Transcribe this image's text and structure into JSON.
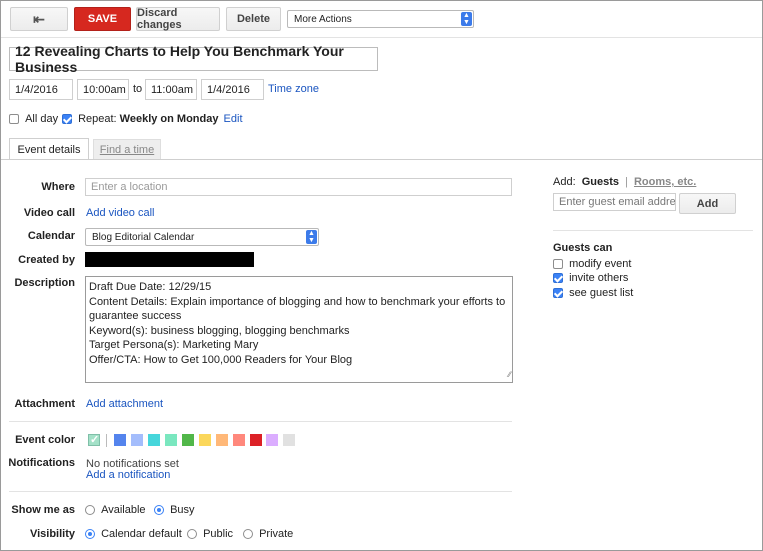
{
  "toolbar": {
    "back_icon": "back-arrow-icon",
    "save_label": "SAVE",
    "discard_label": "Discard changes",
    "delete_label": "Delete",
    "more_actions": "More Actions"
  },
  "event": {
    "title": "12 Revealing Charts to Help You Benchmark Your Business",
    "start_date": "1/4/2016",
    "start_time": "10:00am",
    "to_label": "to",
    "end_time": "11:00am",
    "end_date": "1/4/2016",
    "timezone_link": "Time zone",
    "allday_label": "All day",
    "repeat_label": "Repeat:",
    "repeat_value": "Weekly on Monday",
    "edit_link": "Edit"
  },
  "tabs": {
    "event_details": "Event details",
    "find_time": "Find a time"
  },
  "details": {
    "where_label": "Where",
    "where_placeholder": "Enter a location",
    "video_label": "Video call",
    "video_link": "Add video call",
    "calendar_label": "Calendar",
    "calendar_value": "Blog Editorial Calendar",
    "created_by_label": "Created by",
    "description_label": "Description",
    "description_lines": [
      "Draft Due Date: 12/29/15",
      "Content Details: Explain importance of blogging and how to benchmark your efforts to",
      "guarantee success",
      "Keyword(s): business blogging, blogging benchmarks",
      "Target Persona(s): Marketing Mary",
      "Offer/CTA: How to Get 100,000 Readers for Your Blog"
    ],
    "attachment_label": "Attachment",
    "attachment_link": "Add attachment",
    "event_color_label": "Event color",
    "colors": [
      "#a4e1c8",
      "#5484ed",
      "#a4bdfc",
      "#46d6db",
      "#7ae7bf",
      "#51b749",
      "#fbd75b",
      "#ffb878",
      "#ff887c",
      "#dc2127",
      "#dbadff",
      "#e1e1e1"
    ],
    "notifications_label": "Notifications",
    "no_notifications": "No notifications set",
    "add_notification": "Add a notification",
    "show_me_as_label": "Show me as",
    "available": "Available",
    "busy": "Busy",
    "visibility_label": "Visibility",
    "calendar_default": "Calendar default",
    "public": "Public",
    "private": "Private"
  },
  "guests": {
    "add_label": "Add:",
    "guests_tab": "Guests",
    "separator": "|",
    "rooms_tab": "Rooms, etc.",
    "email_placeholder": "Enter guest email address",
    "add_button": "Add",
    "guests_can": "Guests can",
    "modify_event": "modify event",
    "invite_others": "invite others",
    "see_guest_list": "see guest list"
  }
}
